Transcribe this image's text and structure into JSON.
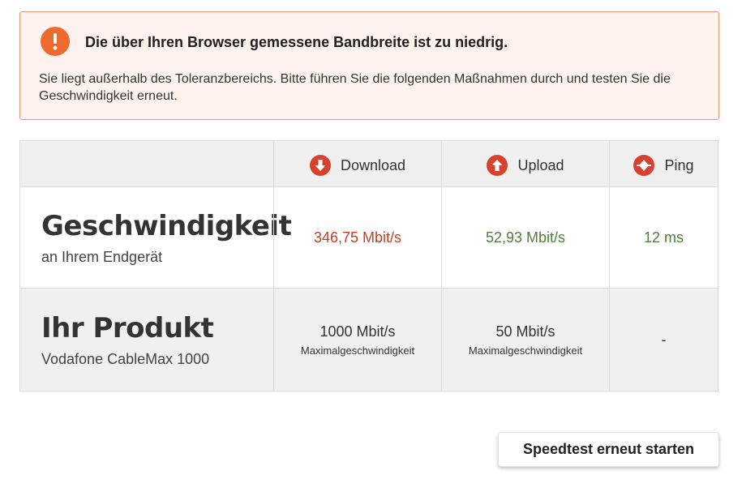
{
  "alert": {
    "icon": "warning-info-icon",
    "icon_glyph": "!",
    "title": "Die über Ihren Browser gemessene Bandbreite ist zu niedrig.",
    "text": "Sie liegt außerhalb des Toleranzbereichs. Bitte führen Sie die folgenden Maßnahmen durch und testen Sie die Geschwindigkeit erneut.",
    "accent_color": "#ef6a2e"
  },
  "table": {
    "headers": {
      "download": "Download",
      "upload": "Upload",
      "ping": "Ping"
    },
    "speed_row": {
      "title": "Geschwindigkeit",
      "subtitle": "an Ihrem Endgerät",
      "download": "346,75 Mbit/s",
      "upload": "52,93 Mbit/s",
      "ping": "12 ms"
    },
    "product_row": {
      "title": "Ihr Produkt",
      "subtitle": "Vodafone CableMax 1000",
      "download": "1000 Mbit/s",
      "download_note": "Maximalgeschwindigkeit",
      "upload": "50 Mbit/s",
      "upload_note": "Maximalgeschwindigkeit",
      "ping": "-"
    },
    "colors": {
      "low_value": "#c3412c",
      "ok_value": "#4f7f38",
      "icon_red": "#d8412d"
    }
  },
  "actions": {
    "restart_label": "Speedtest erneut starten"
  }
}
